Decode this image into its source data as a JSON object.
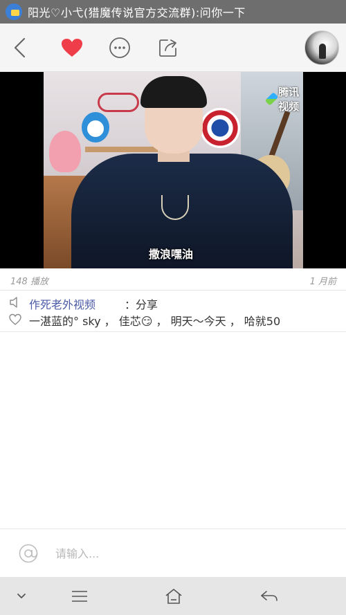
{
  "status_bar": {
    "notification_text": "阳光♡小弋(猎魔传说官方交流群):问你一下"
  },
  "nav": {
    "back_icon": "back-chevron-icon",
    "like_icon": "heart-filled-icon",
    "like_color": "#ef3e4a",
    "more_icon": "more-dots-icon",
    "share_icon": "share-out-icon",
    "avatar": "user-avatar"
  },
  "video": {
    "watermark_logo": "腾讯视频",
    "caption": "撒浪嘿油"
  },
  "meta": {
    "play_count": "148 播放",
    "time_ago": "1 月前"
  },
  "share": {
    "icon": "speaker-icon",
    "author": "作死老外视频",
    "action": "：分享"
  },
  "likes": {
    "icon": "heart-outline-icon",
    "names_text": "一湛蓝的° sky ， 佳芯😏 ， 明天～今天 ， 哈就50"
  },
  "comment": {
    "at_icon": "at-icon",
    "placeholder": "请输入..."
  },
  "system_nav": {
    "hide_icon": "chevron-down-icon",
    "menu_icon": "menu-icon",
    "home_icon": "home-icon",
    "back_icon": "back-arrow-icon"
  },
  "colors": {
    "status_bar": "#6e6e6e",
    "nav_bar": "#f5f5f5",
    "link": "#4a5aa6",
    "system_nav": "#e6e6e6"
  }
}
